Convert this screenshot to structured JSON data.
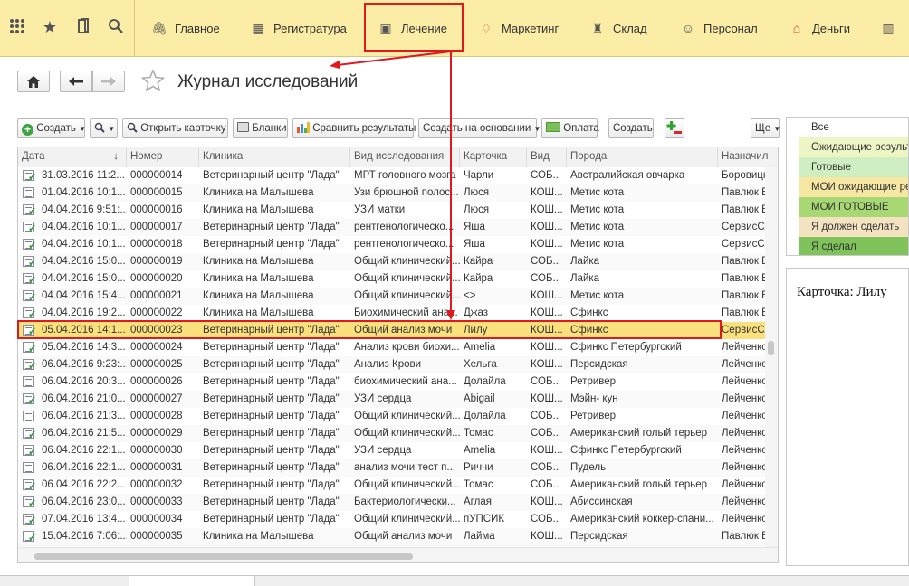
{
  "nav": {
    "items": [
      {
        "label": "Главное",
        "icon": "paperclip-icon"
      },
      {
        "label": "Регистратура",
        "icon": "registry-icon"
      },
      {
        "label": "Лечение",
        "icon": "treatment-icon"
      },
      {
        "label": "Маркетинг",
        "icon": "marketing-icon"
      },
      {
        "label": "Склад",
        "icon": "warehouse-icon"
      },
      {
        "label": "Персонал",
        "icon": "staff-icon"
      },
      {
        "label": "Деньги",
        "icon": "money-icon"
      }
    ]
  },
  "page": {
    "title": "Журнал исследований"
  },
  "toolbar": {
    "create": "Создать",
    "open_card": "Открыть карточку",
    "forms": "Бланки",
    "compare": "Сравнить результаты",
    "create_based": "Создать на основании",
    "payment": "Оплата",
    "create2": "Создать",
    "more": "Ще"
  },
  "table": {
    "columns": [
      "Дата",
      "Номер",
      "Клиника",
      "Вид исследования",
      "Карточка",
      "Вид",
      "Порода",
      "Назначил"
    ],
    "rows": [
      {
        "date": "31.03.2016 11:2...",
        "num": "000000014",
        "clinic": "Ветеринарный центр \"Лада\"",
        "type": "МРТ головного мозга",
        "card": "Чарли",
        "kind": "СОБ...",
        "breed": "Австралийская овчарка",
        "assigned": "Боровицк",
        "done": true
      },
      {
        "date": "01.04.2016 10:1...",
        "num": "000000015",
        "clinic": "Клиника на Малышева",
        "type": "Узи брюшной полос...",
        "card": " Люся",
        "kind": "КОШ...",
        "breed": "Метис кота",
        "assigned": "Павлюк Е",
        "done": false
      },
      {
        "date": "04.04.2016 9:51:...",
        "num": "000000016",
        "clinic": "Клиника на Малышева",
        "type": "УЗИ матки",
        "card": " Люся",
        "kind": "КОШ...",
        "breed": "Метис кота",
        "assigned": "Павлюк Е",
        "done": true
      },
      {
        "date": "04.04.2016 10:1...",
        "num": "000000017",
        "clinic": "Ветеринарный центр \"Лада\"",
        "type": "рентгенологическо...",
        "card": "Яша",
        "kind": "КОШ...",
        "breed": "Метис кота",
        "assigned": "СервисСл",
        "done": true
      },
      {
        "date": "04.04.2016 10:1...",
        "num": "000000018",
        "clinic": "Ветеринарный центр \"Лада\"",
        "type": "рентгенологическо...",
        "card": "Яша",
        "kind": "КОШ...",
        "breed": "Метис кота",
        "assigned": "СервисСл",
        "done": true
      },
      {
        "date": "04.04.2016 15:0...",
        "num": "000000019",
        "clinic": "Клиника на Малышева",
        "type": "Общий клинический...",
        "card": "Кайра",
        "kind": "СОБ...",
        "breed": "Лайка",
        "assigned": "Павлюк Е",
        "done": true
      },
      {
        "date": "04.04.2016 15:0...",
        "num": "000000020",
        "clinic": "Клиника на Малышева",
        "type": "Общий клинический...",
        "card": "Кайра",
        "kind": "СОБ...",
        "breed": "Лайка",
        "assigned": "Павлюк Е",
        "done": true
      },
      {
        "date": "04.04.2016 15:4...",
        "num": "000000021",
        "clinic": "Клиника на Малышева",
        "type": "Общий клинический...",
        "card": "<>",
        "kind": "КОШ...",
        "breed": "Метис кота",
        "assigned": "Павлюк Е",
        "done": true
      },
      {
        "date": "04.04.2016 19:2...",
        "num": "000000022",
        "clinic": "Клиника на Малышева",
        "type": "Биохимический ана...",
        "card": " Джаз",
        "kind": "КОШ...",
        "breed": "Сфинкс",
        "assigned": "Павлюк Е",
        "done": true
      },
      {
        "date": "05.04.2016 14:1...",
        "num": "000000023",
        "clinic": "Ветеринарный центр \"Лада\"",
        "type": "Общий анализ мочи",
        "card": "Лилу",
        "kind": "КОШ...",
        "breed": "Сфинкс",
        "assigned": "СервисСл",
        "done": true,
        "selected": true
      },
      {
        "date": "05.04.2016 14:3...",
        "num": "000000024",
        "clinic": "Ветеринарный центр \"Лада\"",
        "type": "Анализ крови биохи...",
        "card": "Amelia",
        "kind": "КОШ...",
        "breed": "Сфинкс Петербургский",
        "assigned": "Лейченко",
        "done": true
      },
      {
        "date": "06.04.2016 9:23:...",
        "num": "000000025",
        "clinic": "Ветеринарный центр \"Лада\"",
        "type": "Анализ Крови",
        "card": "Хельга",
        "kind": "КОШ...",
        "breed": "Персидская",
        "assigned": "Лейченко",
        "done": true
      },
      {
        "date": "06.04.2016 20:3...",
        "num": "000000026",
        "clinic": "Ветеринарный центр \"Лада\"",
        "type": "биохимический ана...",
        "card": "Долайла",
        "kind": "СОБ...",
        "breed": "Ретривер",
        "assigned": "Лейченко",
        "done": false
      },
      {
        "date": "06.04.2016 21:0...",
        "num": "000000027",
        "clinic": "Ветеринарный центр \"Лада\"",
        "type": "УЗИ сердца",
        "card": "Abigail",
        "kind": "КОШ...",
        "breed": "Мэйн- кун",
        "assigned": "Лейченко",
        "done": true
      },
      {
        "date": "06.04.2016 21:3...",
        "num": "000000028",
        "clinic": "Ветеринарный центр \"Лада\"",
        "type": "Общий клинический...",
        "card": "Долайла",
        "kind": "СОБ...",
        "breed": "Ретривер",
        "assigned": "Лейченко",
        "done": false
      },
      {
        "date": "06.04.2016 21:5...",
        "num": "000000029",
        "clinic": "Ветеринарный центр \"Лада\"",
        "type": "Общий клинический...",
        "card": "Томас",
        "kind": "СОБ...",
        "breed": "Американский голый терьер",
        "assigned": "Лейченко",
        "done": true
      },
      {
        "date": "06.04.2016 22:1...",
        "num": "000000030",
        "clinic": "Ветеринарный центр \"Лада\"",
        "type": "УЗИ сердца",
        "card": "Amelia",
        "kind": "КОШ...",
        "breed": "Сфинкс Петербургский",
        "assigned": "Лейченко",
        "done": true
      },
      {
        "date": "06.04.2016 22:1...",
        "num": "000000031",
        "clinic": "Ветеринарный центр \"Лада\"",
        "type": "анализ мочи тест п...",
        "card": "Риччи",
        "kind": "СОБ...",
        "breed": "Пудель",
        "assigned": "Лейченко",
        "done": false
      },
      {
        "date": "06.04.2016 22:2...",
        "num": "000000032",
        "clinic": "Ветеринарный центр \"Лада\"",
        "type": "Общий клинический...",
        "card": "Томас",
        "kind": "СОБ...",
        "breed": "Американский голый терьер",
        "assigned": "Лейченко",
        "done": true
      },
      {
        "date": "06.04.2016 23:0...",
        "num": "000000033",
        "clinic": "Ветеринарный центр \"Лада\"",
        "type": "Бактериологически...",
        "card": "Аглая",
        "kind": "КОШ...",
        "breed": "Абиссинская",
        "assigned": "Лейченко",
        "done": true
      },
      {
        "date": "07.04.2016 13:4...",
        "num": "000000034",
        "clinic": "Ветеринарный центр \"Лада\"",
        "type": "Общий клинический...",
        "card": "пУПСИК",
        "kind": "СОБ...",
        "breed": "Американский коккер-спани...",
        "assigned": "Лейченко",
        "done": true
      },
      {
        "date": "15.04.2016 7:06:...",
        "num": "000000035",
        "clinic": "Клиника на Малышева",
        "type": "Общий анализ мочи",
        "card": "Лайма",
        "kind": "КОШ...",
        "breed": "Персидская",
        "assigned": "Павлюк Е",
        "done": true
      }
    ]
  },
  "filters": {
    "items": [
      {
        "label": "Все",
        "color": "#ffffff"
      },
      {
        "label": "Ожидающие результ",
        "color": "#eef5c4"
      },
      {
        "label": "Готовые",
        "color": "#cfeec1"
      },
      {
        "label": "МОИ ожидающие рез",
        "color": "#f6e7a3"
      },
      {
        "label": "МОИ ГОТОВЫЕ",
        "color": "#a8d873"
      },
      {
        "label": "Я должен сделать",
        "color": "#f3e3c1"
      },
      {
        "label": "Я сделал",
        "color": "#7fc35a"
      }
    ]
  },
  "card": {
    "text": "Карточка: Лилу"
  },
  "colors": {
    "accent_red": "#e0191f",
    "selected_row": "#fbe17e",
    "topbar": "#fbeca6"
  }
}
